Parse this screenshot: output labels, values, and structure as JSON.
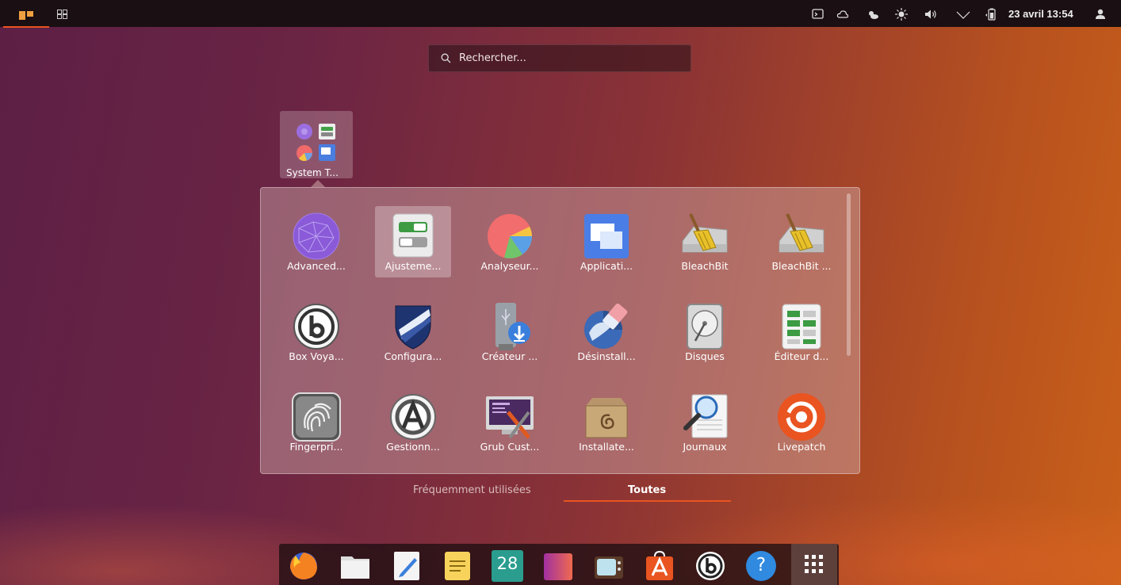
{
  "topbar": {
    "clock": "23 avril 13:54"
  },
  "search": {
    "placeholder": "Rechercher..."
  },
  "folder": {
    "label": "System T..."
  },
  "apps": [
    {
      "label": "Advanced...",
      "icon": "advanced-network-icon"
    },
    {
      "label": "Ajusteme...",
      "icon": "tweaks-icon"
    },
    {
      "label": "Analyseur...",
      "icon": "disk-usage-analyzer-icon"
    },
    {
      "label": "Applicati...",
      "icon": "applications-icon"
    },
    {
      "label": "BleachBit",
      "icon": "bleachbit-icon"
    },
    {
      "label": "BleachBit ...",
      "icon": "bleachbit-root-icon"
    },
    {
      "label": "Box Voya...",
      "icon": "box-voyager-icon"
    },
    {
      "label": "Configura...",
      "icon": "firewall-config-icon"
    },
    {
      "label": "Créateur ...",
      "icon": "usb-creator-icon"
    },
    {
      "label": "Désinstall...",
      "icon": "uninstaller-icon"
    },
    {
      "label": "Disques",
      "icon": "disks-icon"
    },
    {
      "label": "Éditeur d...",
      "icon": "dconf-editor-icon"
    },
    {
      "label": "Fingerpri...",
      "icon": "fingerprint-icon"
    },
    {
      "label": "Gestionn...",
      "icon": "software-manager-icon"
    },
    {
      "label": "Grub Cust...",
      "icon": "grub-customizer-icon"
    },
    {
      "label": "Installate...",
      "icon": "package-installer-icon"
    },
    {
      "label": "Journaux",
      "icon": "logs-icon"
    },
    {
      "label": "Livepatch",
      "icon": "livepatch-icon"
    }
  ],
  "tabs": {
    "frequent": "Fréquemment utilisées",
    "all": "Toutes"
  },
  "dock": {
    "calendar_day": "28",
    "help_glyph": "?"
  },
  "colors": {
    "accent": "#e95420",
    "topbar": "#1a0f12"
  }
}
